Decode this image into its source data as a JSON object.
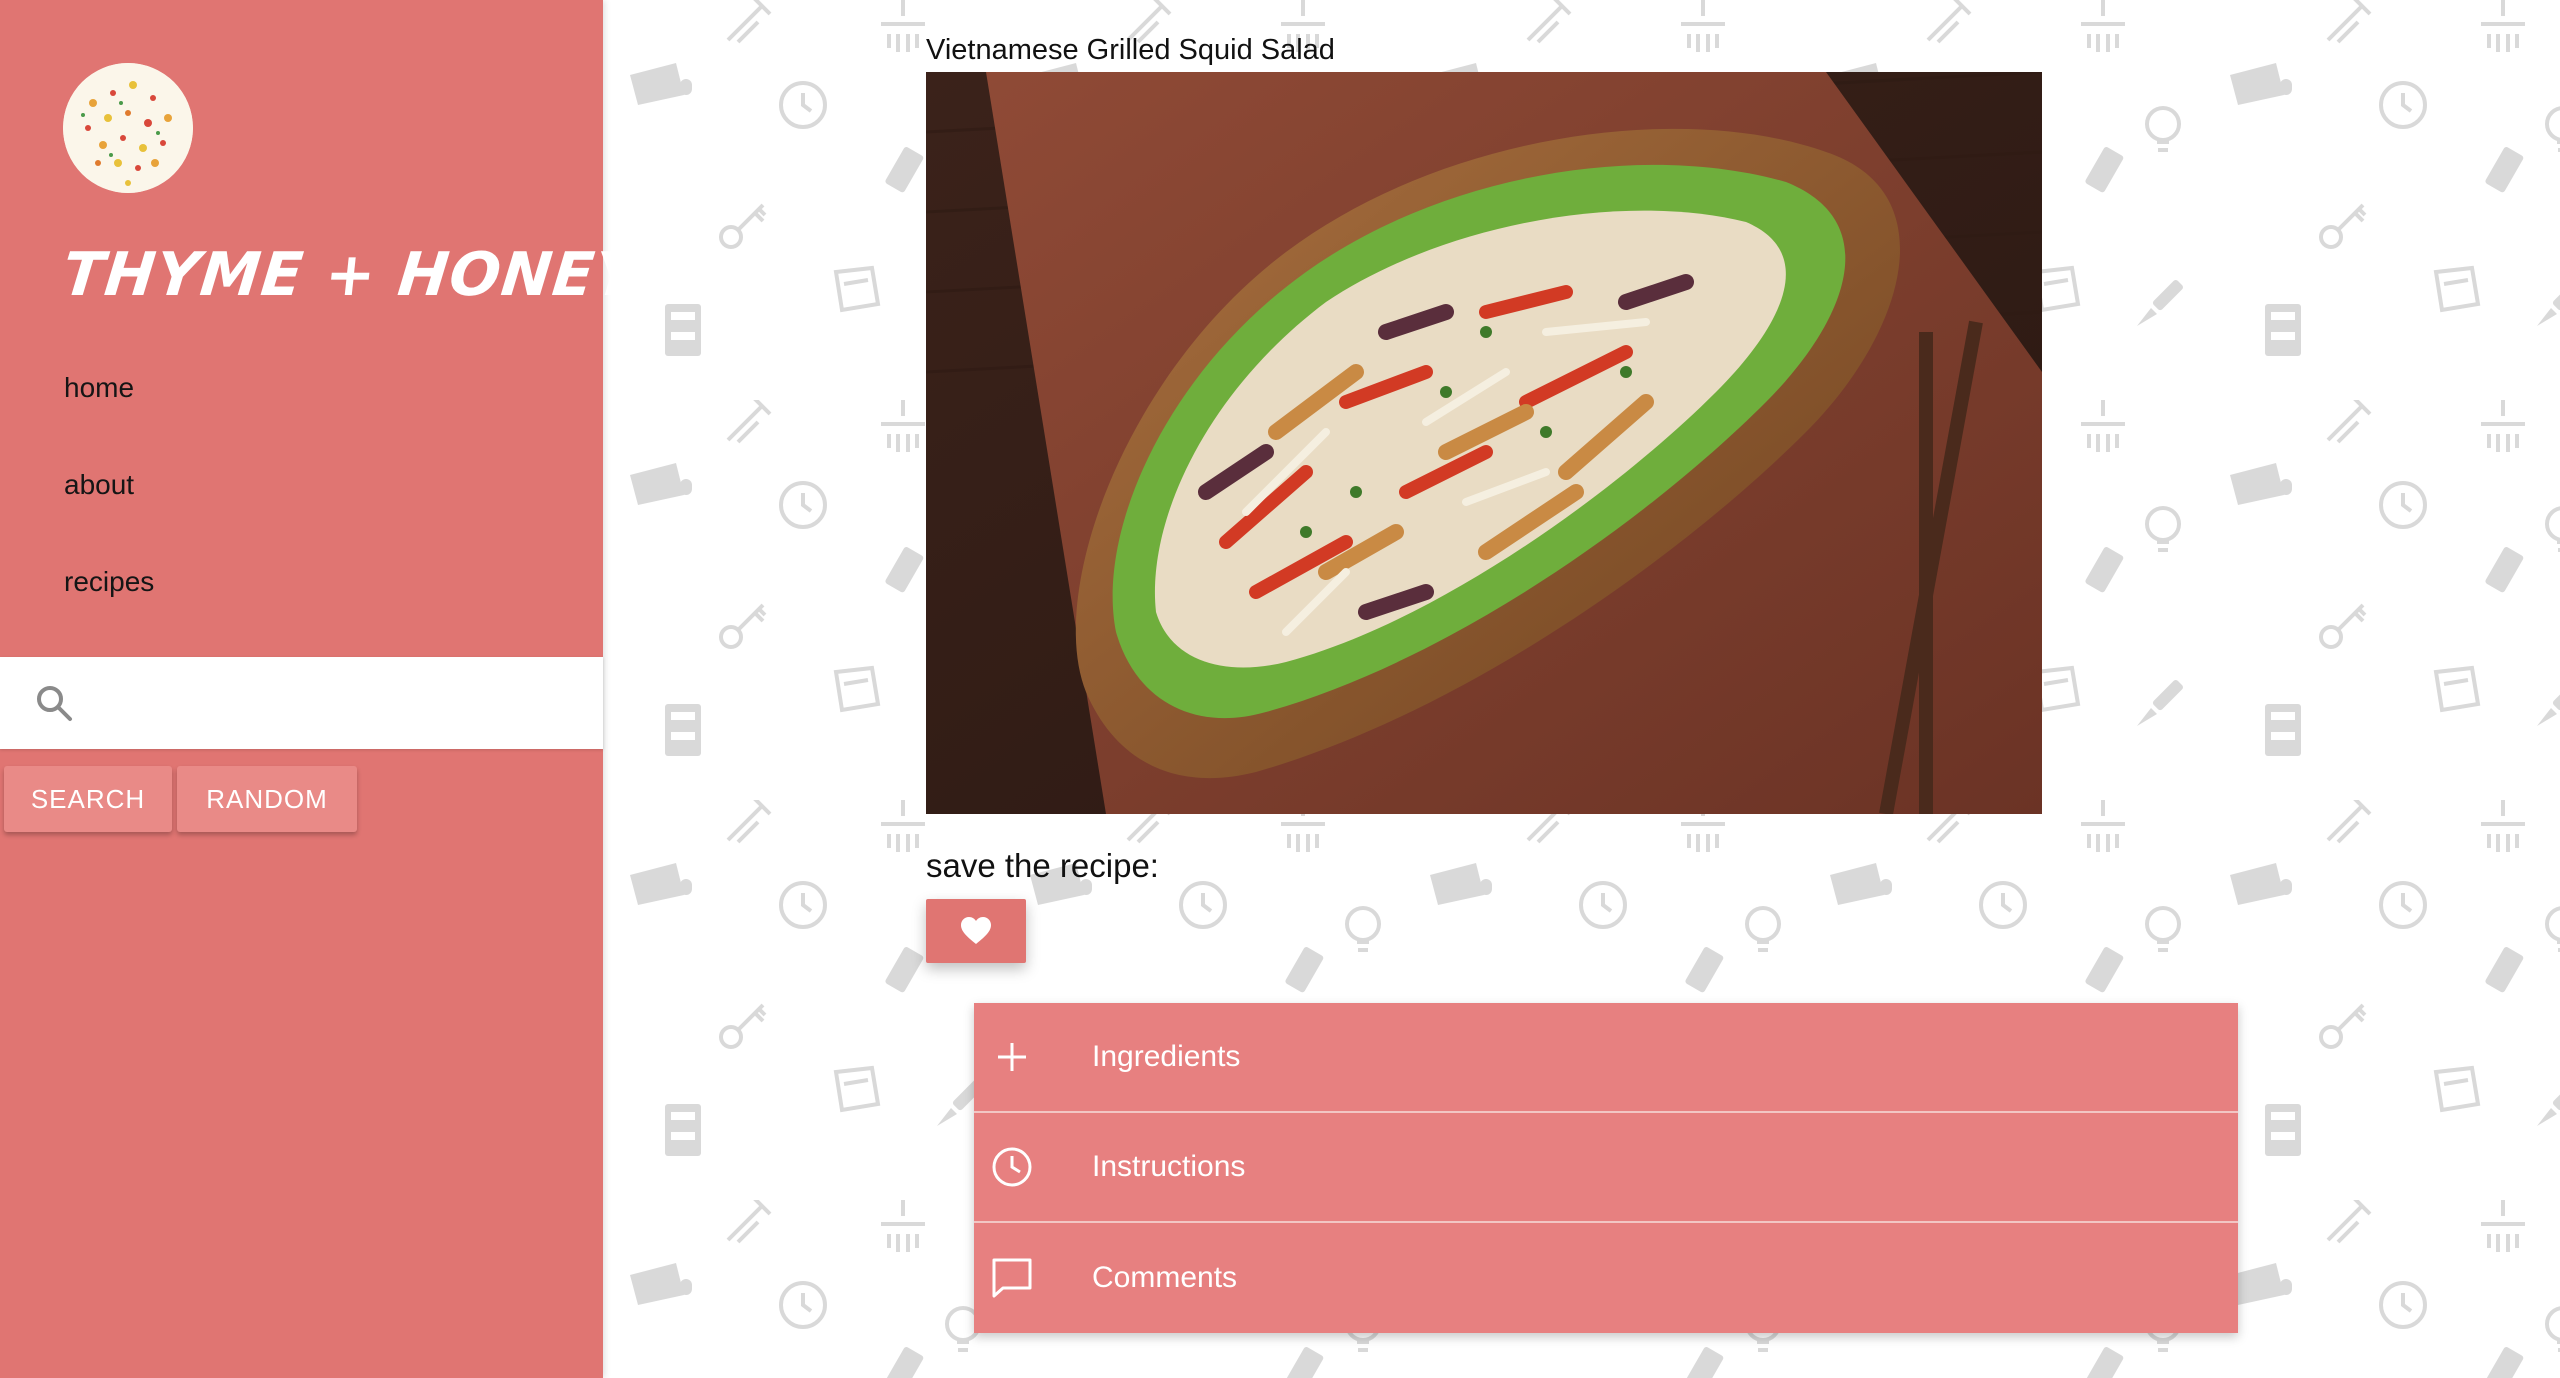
{
  "sidebar": {
    "brand": "THYME + HONEY",
    "nav": [
      {
        "label": "home"
      },
      {
        "label": "about"
      },
      {
        "label": "recipes"
      }
    ],
    "search": {
      "placeholder": "",
      "value": ""
    },
    "buttons": {
      "search": "SEARCH",
      "random": "RANDOM"
    }
  },
  "recipe": {
    "title": "Vietnamese Grilled Squid Salad",
    "save_label": "save the recipe:"
  },
  "accordion": [
    {
      "label": "Ingredients",
      "icon": "plus-icon"
    },
    {
      "label": "Instructions",
      "icon": "clock-icon"
    },
    {
      "label": "Comments",
      "icon": "comment-icon"
    }
  ],
  "colors": {
    "sidebar": "#e07572",
    "accent": "#e78080",
    "button": "#e98a87"
  }
}
